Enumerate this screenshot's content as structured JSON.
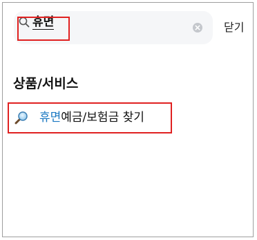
{
  "search": {
    "query": "휴면",
    "clear_icon": "clear-circle-icon",
    "search_icon": "magnifier-icon"
  },
  "header": {
    "close_label": "닫기"
  },
  "results": {
    "section_title": "상품/서비스",
    "items": [
      {
        "highlight": "휴면",
        "rest": "예금/보험금 찾기",
        "icon": "magnifier-glass-icon"
      }
    ]
  },
  "colors": {
    "highlight": "#1a78c2",
    "annotation_box": "#e02020",
    "search_bg": "#f5f6f8"
  }
}
